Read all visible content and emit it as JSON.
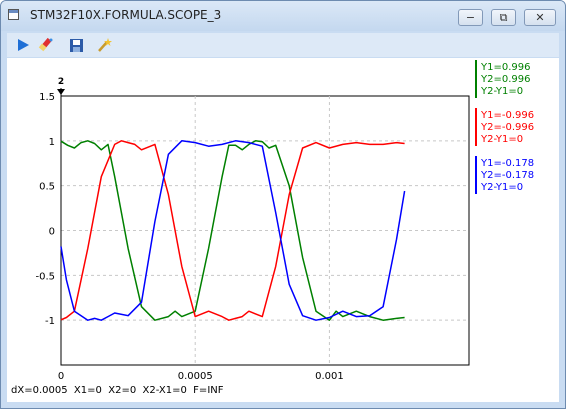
{
  "window": {
    "title": "STM32F10X.FORMULA.SCOPE_3"
  },
  "controls": {
    "minimize_glyph": "−",
    "restore_glyph": "⧉",
    "close_glyph": "✕"
  },
  "toolbar": {
    "icons": [
      "play-icon",
      "erase-icon",
      "save-icon",
      "magic-wand-icon"
    ]
  },
  "chart_data": {
    "type": "line",
    "xlim": [
      0,
      0.00152
    ],
    "ylim": [
      -1.5,
      1.5
    ],
    "x_ticks": [
      0,
      0.0005,
      0.001
    ],
    "x_tick_labels": [
      "0",
      "0.0005",
      "0.001"
    ],
    "y_ticks": [
      1.5,
      1,
      0.5,
      0,
      -0.5,
      -1
    ],
    "y_tick_labels": [
      "1.5",
      "1",
      "0.5",
      "0",
      "-0.5",
      "-1"
    ],
    "grid": true,
    "cursor_label": "2",
    "series": [
      {
        "color": "#008000",
        "x": [
          0,
          2.5e-05,
          5e-05,
          7.5e-05,
          0.0001,
          0.000125,
          0.00015,
          0.000175,
          0.0002,
          0.00025,
          0.0003,
          0.00035,
          0.0004,
          0.000425,
          0.00045,
          0.0005,
          0.00055,
          0.0006,
          0.000625,
          0.00065,
          0.000675,
          0.0007,
          0.000725,
          0.00075,
          0.000775,
          0.0008,
          0.00085,
          0.0009,
          0.00095,
          0.001,
          0.001025,
          0.00105,
          0.0011,
          0.00115,
          0.0012,
          0.00125,
          0.00128
        ],
        "y": [
          0.996,
          0.95,
          0.92,
          0.98,
          1.0,
          0.97,
          0.9,
          0.96,
          0.6,
          -0.2,
          -0.85,
          -1.0,
          -0.96,
          -0.9,
          -0.96,
          -0.9,
          -0.2,
          0.6,
          0.95,
          0.95,
          0.9,
          0.96,
          1.0,
          0.99,
          0.92,
          0.95,
          0.5,
          -0.3,
          -0.9,
          -1.0,
          -0.9,
          -0.96,
          -0.9,
          -0.96,
          -1.0,
          -0.98,
          -0.97
        ]
      },
      {
        "color": "#ff0000",
        "x": [
          0,
          2e-05,
          5e-05,
          0.0001,
          0.00015,
          0.0002,
          0.000225,
          0.00025,
          0.000275,
          0.0003,
          0.00035,
          0.0004,
          0.00045,
          0.0005,
          0.00055,
          0.0006,
          0.000625,
          0.00065,
          0.000675,
          0.0007,
          0.00075,
          0.0008,
          0.00085,
          0.0009,
          0.00095,
          0.001,
          0.00105,
          0.0011,
          0.00115,
          0.0012,
          0.00125,
          0.00128
        ],
        "y": [
          -0.996,
          -0.97,
          -0.9,
          -0.2,
          0.6,
          0.96,
          1.0,
          0.98,
          0.96,
          0.9,
          0.96,
          0.4,
          -0.4,
          -0.96,
          -0.9,
          -0.96,
          -1.0,
          -0.98,
          -0.96,
          -0.9,
          -0.96,
          -0.4,
          0.4,
          0.92,
          0.98,
          0.92,
          0.96,
          0.98,
          0.96,
          0.96,
          0.98,
          0.97
        ]
      },
      {
        "color": "#0000ff",
        "x": [
          0,
          2e-05,
          5e-05,
          0.0001,
          0.000125,
          0.00015,
          0.000175,
          0.0002,
          0.00025,
          0.0003,
          0.00035,
          0.0004,
          0.00045,
          0.0005,
          0.00055,
          0.0006,
          0.00065,
          0.0007,
          0.00075,
          0.0008,
          0.00085,
          0.0009,
          0.00095,
          0.001,
          0.00105,
          0.0011,
          0.00115,
          0.0012,
          0.00125,
          0.00128
        ],
        "y": [
          -0.178,
          -0.55,
          -0.9,
          -1.0,
          -0.98,
          -1.0,
          -0.96,
          -0.92,
          -0.95,
          -0.8,
          0.1,
          0.85,
          1.0,
          0.98,
          0.94,
          0.96,
          1.0,
          0.98,
          0.94,
          0.2,
          -0.6,
          -0.95,
          -1.0,
          -0.97,
          -0.9,
          -0.96,
          -0.95,
          -0.85,
          -0.1,
          0.44
        ]
      }
    ]
  },
  "readouts": [
    {
      "color": "#008000",
      "lines": [
        "Y1=0.996",
        "Y2=0.996",
        "Y2-Y1=0"
      ]
    },
    {
      "color": "#ff0000",
      "lines": [
        "Y1=-0.996",
        "Y2=-0.996",
        "Y2-Y1=0"
      ]
    },
    {
      "color": "#0000ff",
      "lines": [
        "Y1=-0.178",
        "Y2=-0.178",
        "Y2-Y1=0"
      ]
    }
  ],
  "status": {
    "text": "dX=0.0005  X1=0  X2=0  X2-X1=0  F=INF"
  }
}
